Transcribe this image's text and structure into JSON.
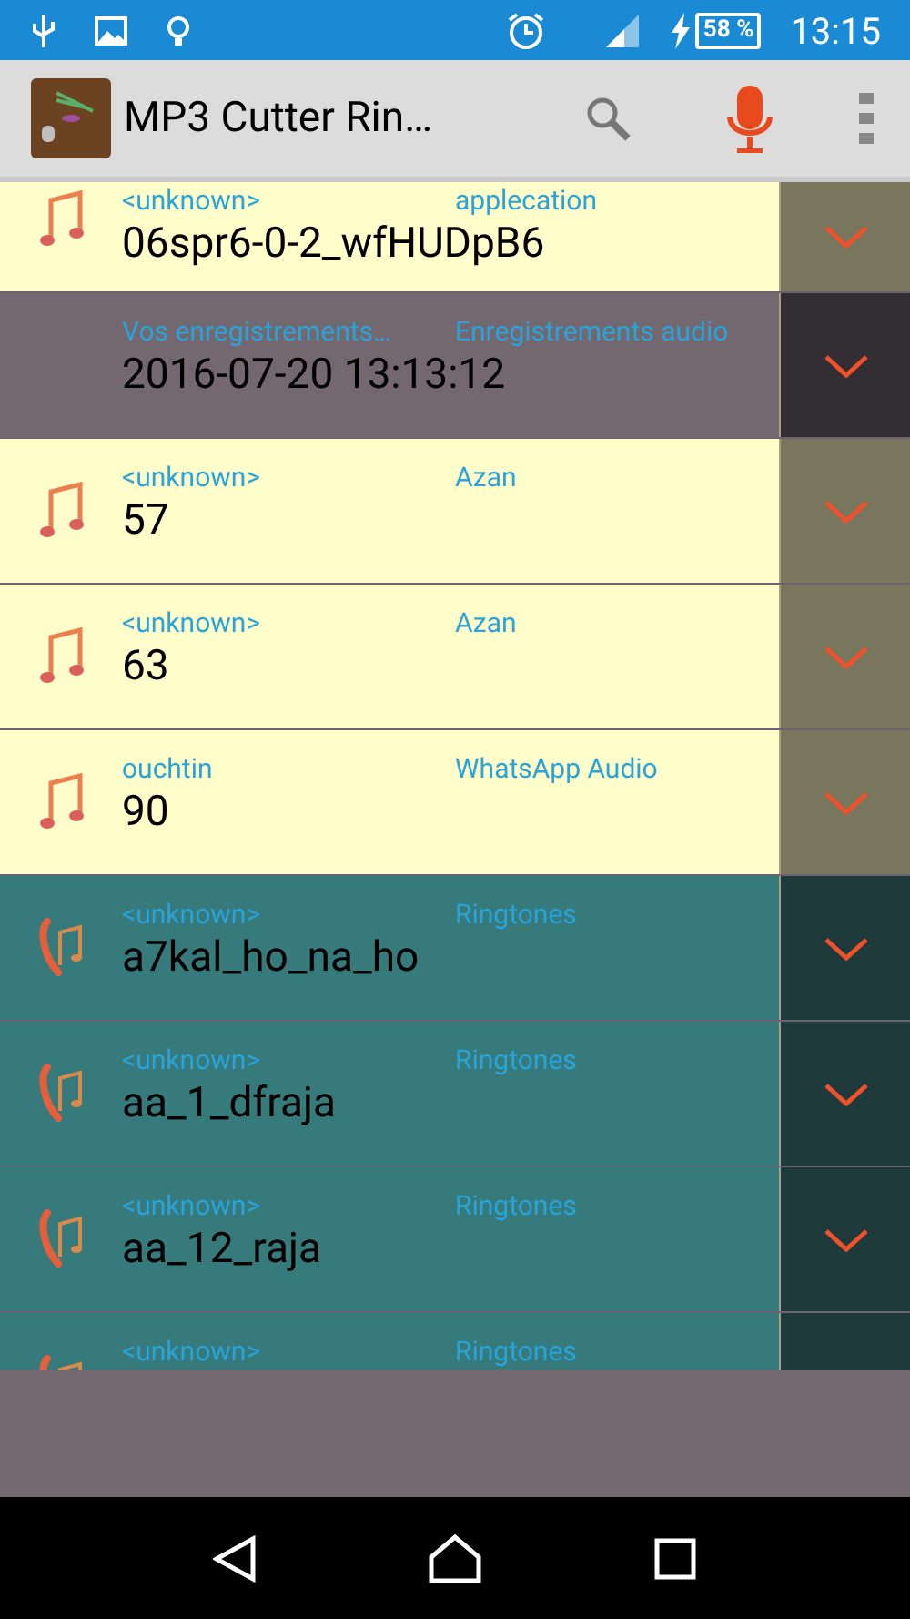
{
  "status_bar": {
    "battery": "58 %",
    "time": "13:15"
  },
  "app_bar": {
    "title": "MP3 Cutter Rin…"
  },
  "rows": [
    {
      "kind": "music",
      "artist": "<unknown>",
      "album": "applecation",
      "title": "06spr6-0-2_wfHUDpB6"
    },
    {
      "kind": "recording",
      "artist": "Vos enregistrements…",
      "album": "Enregistrements audio",
      "title": "2016-07-20 13:13:12"
    },
    {
      "kind": "music",
      "artist": "<unknown>",
      "album": "Azan",
      "title": "57"
    },
    {
      "kind": "music",
      "artist": "<unknown>",
      "album": "Azan",
      "title": "63"
    },
    {
      "kind": "music",
      "artist": "ouchtin",
      "album": "WhatsApp Audio",
      "title": "90"
    },
    {
      "kind": "ringtone",
      "artist": "<unknown>",
      "album": "Ringtones",
      "title": "a7kal_ho_na_ho"
    },
    {
      "kind": "ringtone",
      "artist": "<unknown>",
      "album": "Ringtones",
      "title": "aa_1_dfraja"
    },
    {
      "kind": "ringtone",
      "artist": "<unknown>",
      "album": "Ringtones",
      "title": "aa_12_raja"
    },
    {
      "kind": "ringtone",
      "artist": "<unknown>",
      "album": "Ringtones"
    }
  ]
}
